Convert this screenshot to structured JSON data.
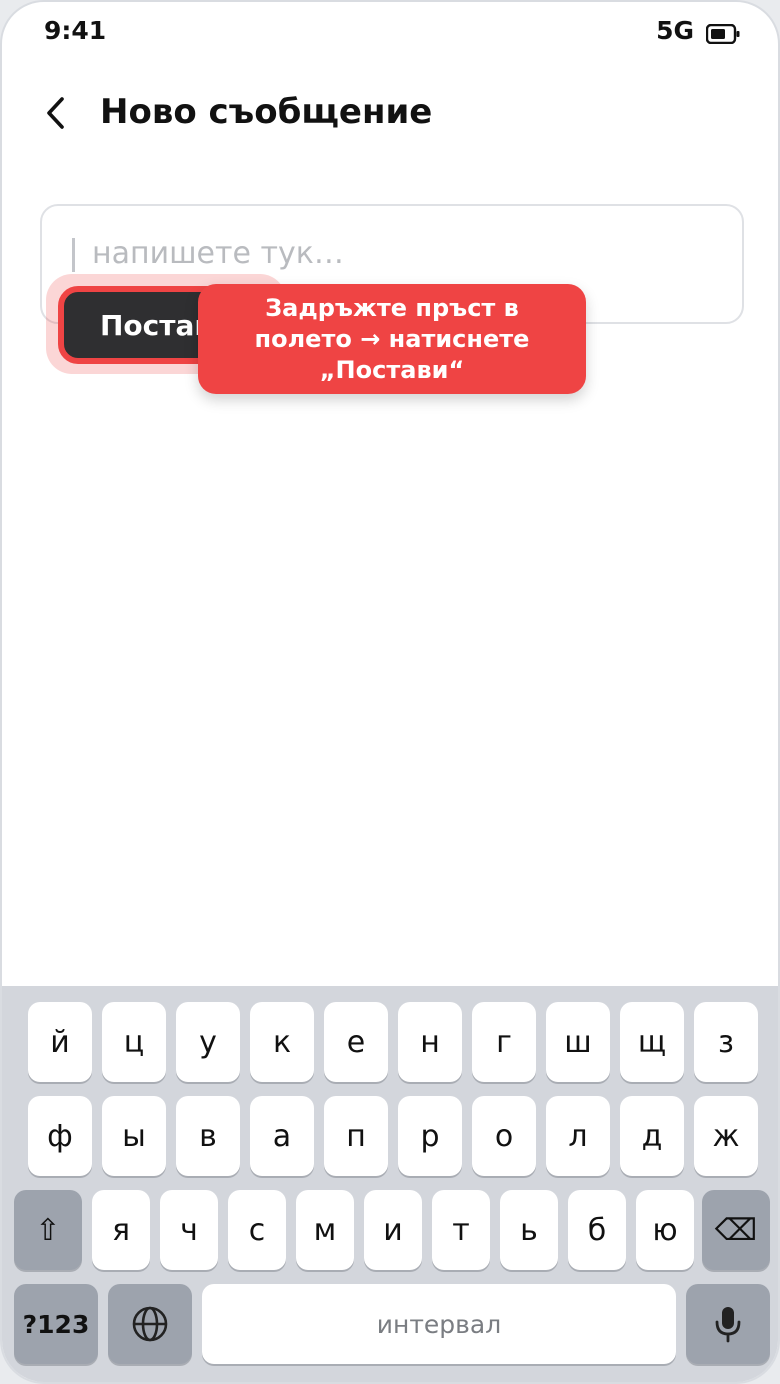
{
  "status_bar": {
    "time": "9:41",
    "network": "5G",
    "battery_icon": "battery-icon"
  },
  "header": {
    "back_icon": "chevron-left-icon",
    "title": "Ново съобщение"
  },
  "message_field": {
    "placeholder": "напишете тук…",
    "value": ""
  },
  "paste_button": {
    "label": "Постави",
    "visible_label": "Постав"
  },
  "tooltip": {
    "text": "Задръжте пръст в полето → натиснете „Постави“"
  },
  "keyboard": {
    "row1": [
      "й",
      "ц",
      "у",
      "к",
      "е",
      "н",
      "г",
      "ш",
      "щ",
      "з"
    ],
    "row2": [
      "ф",
      "ы",
      "в",
      "а",
      "п",
      "р",
      "о",
      "л",
      "д",
      "ж"
    ],
    "row3": [
      "я",
      "ч",
      "с",
      "м",
      "и",
      "т",
      "ь",
      "б",
      "ю"
    ],
    "shift_key": "⇧",
    "backspace_key": "⌫",
    "numbers_key": "?123",
    "globe_icon": "globe-icon",
    "space_label": "интервал",
    "mic_icon": "microphone-icon"
  },
  "colors": {
    "accent": "#ef4444",
    "paste_bg": "#2f2f31",
    "keyboard_bg": "#d3d6dc",
    "fn_key": "#9da3ad"
  }
}
